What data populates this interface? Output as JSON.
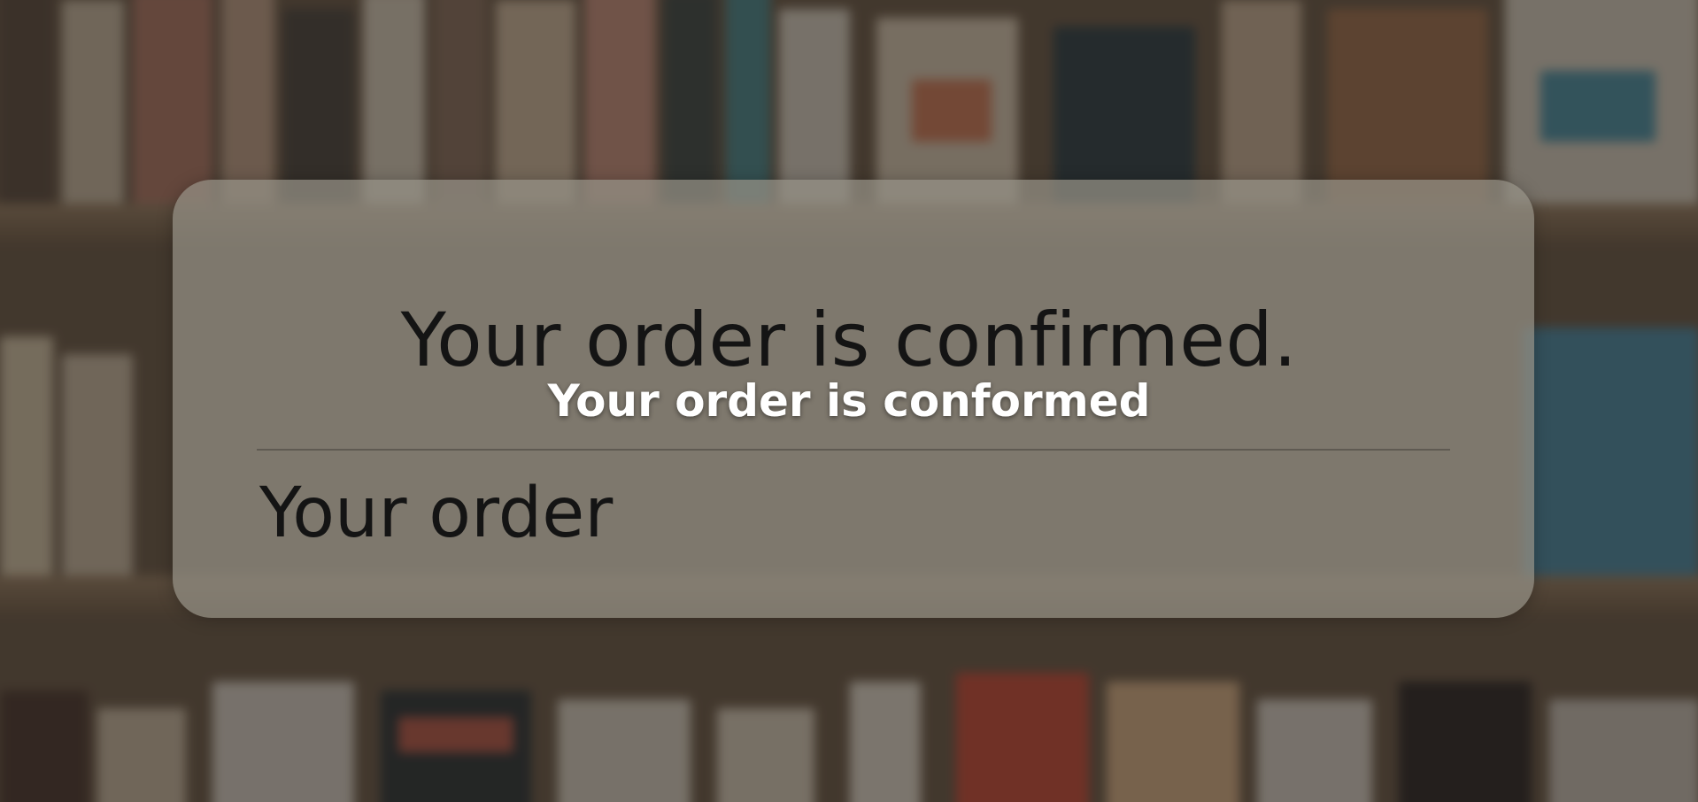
{
  "notification": {
    "title": "Your order is confirmed.",
    "subtitle": "Your order"
  },
  "caption": {
    "text": "Your order is conformed"
  },
  "colors": {
    "card_background": "#968f86",
    "text_dark": "#141414",
    "caption_text": "#ffffff",
    "background_overlay": "#1e1a16"
  }
}
